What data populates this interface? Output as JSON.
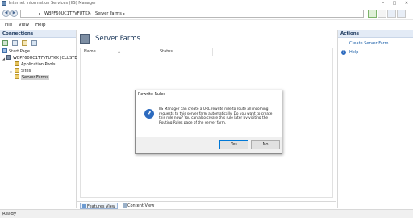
{
  "window": {
    "title": "Internet Information Services (IIS) Manager",
    "min_glyph": "–",
    "max_glyph": "□",
    "close_glyph": "✕"
  },
  "addressbar": {
    "back_glyph": "◀",
    "forward_glyph": "▶",
    "separator_glyph": "▸",
    "crumbs": [
      "WBPF60UC1T7VFUTKX",
      "Server Farms"
    ]
  },
  "menu": {
    "items": [
      "File",
      "View",
      "Help"
    ]
  },
  "connections": {
    "header": "Connections",
    "tree": [
      {
        "label": "Start Page",
        "icon": "start-page-icon"
      },
      {
        "label": "WBPF60UC1T7VFUTKX (CLUSTE",
        "icon": "server-icon",
        "expander": "◢"
      },
      {
        "label": "Application Pools",
        "icon": "app-pools-icon"
      },
      {
        "label": "Sites",
        "icon": "sites-folder-icon",
        "expander": "▷"
      },
      {
        "label": "Server Farms",
        "icon": "server-farms-icon",
        "selected": true
      }
    ]
  },
  "content": {
    "heading": "Server Farms",
    "columns": [
      "Name",
      "Status"
    ],
    "sort_glyph": "▲"
  },
  "bottom_tabs": [
    "Features View",
    "Content View"
  ],
  "actions": {
    "header": "Actions",
    "items": [
      "Create Server Farm...",
      "Help"
    ],
    "help_glyph": "?"
  },
  "status": {
    "text": "Ready"
  },
  "dialog": {
    "title": "Rewrite Rules",
    "icon_glyph": "?",
    "message": "IIS Manager can create a URL rewrite rule to route all incoming requests to this server farm automatically. Do you want to create this rule now? You can also create this rule later by visiting the Routing Rules page of the server farm.",
    "yes_label": "Yes",
    "no_label": "No"
  },
  "colors": {
    "accent": "#1a5ea8",
    "pane_header": "#e3ebf6",
    "dialog_bg": "#f0f0f0"
  }
}
